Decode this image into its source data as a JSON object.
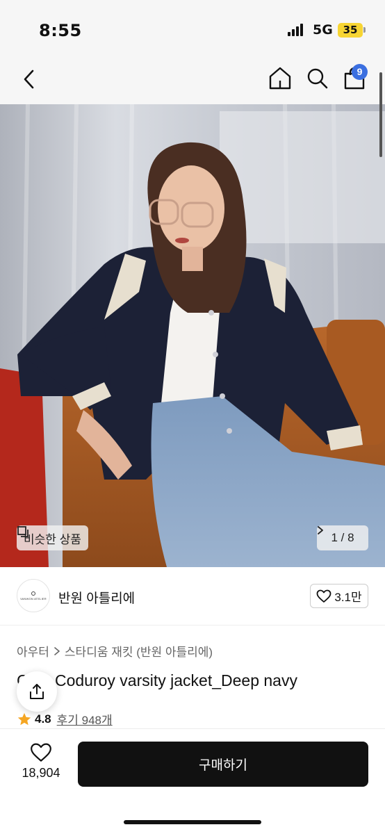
{
  "status_bar": {
    "time": "8:55",
    "network": "5G",
    "battery": "35"
  },
  "nav": {
    "back_icon": "chevron-left-icon",
    "home_icon": "home-icon",
    "search_icon": "search-icon",
    "cart_icon": "shopping-bag-icon",
    "cart_count": "9"
  },
  "hero": {
    "similar_label": "비슷한 상품",
    "image_counter": "1 / 8",
    "image_index": 1,
    "image_total": 8
  },
  "shop": {
    "logo_text": "VANWON ATELIER",
    "name": "반원 아틀리에",
    "likes": "3.1만"
  },
  "product": {
    "breadcrumb": [
      "아우터",
      "스타디움 재킷 (반원 아틀리에)"
    ],
    "title": "C     00 Coduroy varsity jacket_Deep navy",
    "rating": "4.8",
    "reviews": "후기 948개"
  },
  "bottom": {
    "wish_count": "18,904",
    "buy_label": "구매하기"
  },
  "colors": {
    "accent_badge": "#3b6fe0",
    "buy_button": "#111111",
    "star": "#f5a623",
    "battery": "#f7d533"
  }
}
